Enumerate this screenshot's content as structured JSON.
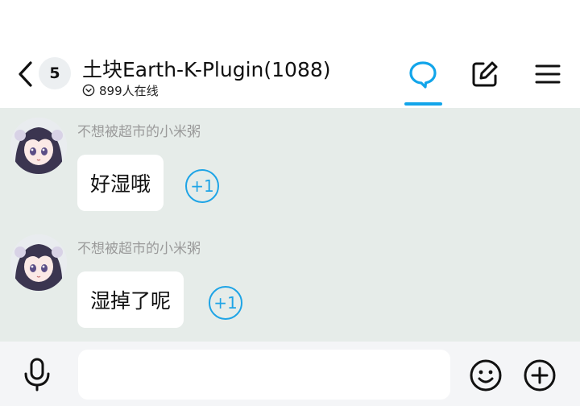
{
  "header": {
    "unread_count": "5",
    "title": "土块Earth-K-Plugin(1088)",
    "online_text": "899人在线"
  },
  "messages": [
    {
      "sender": "不想被超市的小米粥",
      "text": "好湿哦",
      "plus_one": "+1"
    },
    {
      "sender": "不想被超市的小米粥",
      "text": "湿掉了呢",
      "plus_one": "+1"
    }
  ],
  "input": {
    "placeholder": ""
  },
  "colors": {
    "accent": "#12a5ea",
    "chat_background": "#e6ece9",
    "bubble": "#ffffff",
    "sender_name": "#9a9a9a"
  },
  "icons": [
    "back-chevron-icon",
    "chat-bubble-icon",
    "edit-icon",
    "hamburger-menu-icon",
    "microphone-icon",
    "emoji-icon",
    "plus-circle-icon",
    "online-status-icon"
  ]
}
